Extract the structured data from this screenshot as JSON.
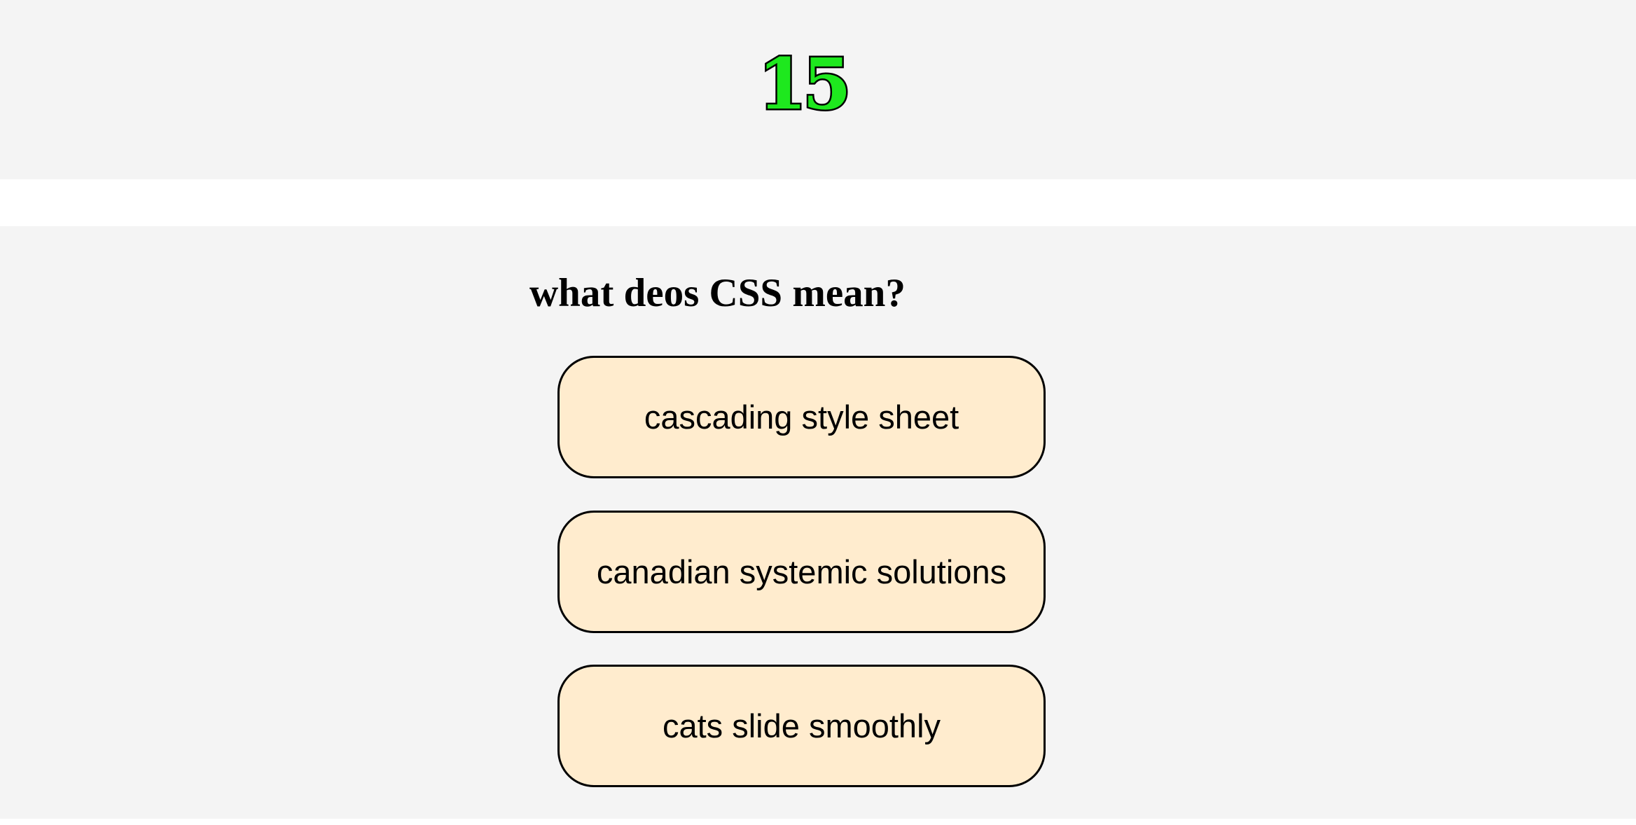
{
  "timer": {
    "value": "15",
    "color": "#1ee81e",
    "outline_color": "#000000"
  },
  "question": {
    "text": "what deos CSS mean?"
  },
  "answers": [
    {
      "label": "cascading style sheet"
    },
    {
      "label": "canadian systemic solutions"
    },
    {
      "label": "cats slide smoothly"
    }
  ],
  "colors": {
    "panel_background": "#f4f4f4",
    "page_background": "#ffffff",
    "answer_background": "#ffecce",
    "answer_border": "#000000"
  }
}
